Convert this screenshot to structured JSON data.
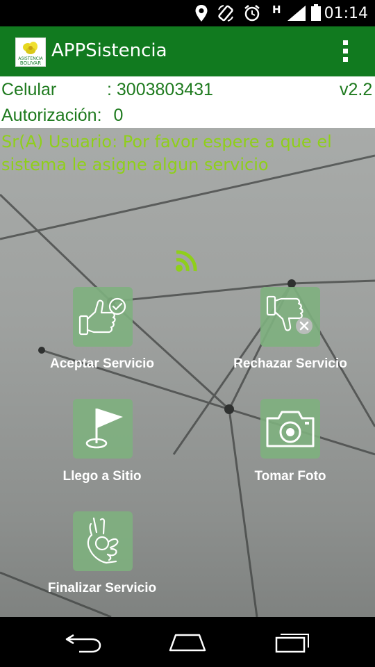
{
  "status_bar": {
    "time": "01:14",
    "network_indicator": "H",
    "icons": [
      "location-icon",
      "rotate-icon",
      "alarm-icon",
      "signal-icon",
      "battery-icon"
    ]
  },
  "app_bar": {
    "title": "APPSistencia",
    "logo_text_top": "ASISTENCIA",
    "logo_text_bottom": "BOLIVAR",
    "menu_icon": "overflow-menu-icon"
  },
  "info": {
    "celular_label": "Celular",
    "celular_value": ": 3003803431",
    "version": "v2.2",
    "autorizacion_label": "Autorización:",
    "autorizacion_value": "0"
  },
  "message": "Sr(A) Usuario: Por favor espere a que el sistema le asigne algun servicio",
  "actions": [
    {
      "label": "Aceptar Servicio",
      "icon": "thumbs-up-check-icon"
    },
    {
      "label": "Rechazar Servicio",
      "icon": "thumbs-down-x-icon"
    },
    {
      "label": "Llego a Sitio",
      "icon": "flag-location-icon"
    },
    {
      "label": "Tomar Foto",
      "icon": "camera-icon"
    },
    {
      "label": "Finalizar Servicio",
      "icon": "ok-hand-icon"
    }
  ],
  "colors": {
    "app_bar": "#117a1f",
    "info_text": "#1e7a1e",
    "message_text": "#8fcf1a",
    "tile_bg": "#7eb07e"
  },
  "nav_bar": {
    "icons": [
      "back-icon",
      "home-icon",
      "recent-apps-icon"
    ]
  }
}
